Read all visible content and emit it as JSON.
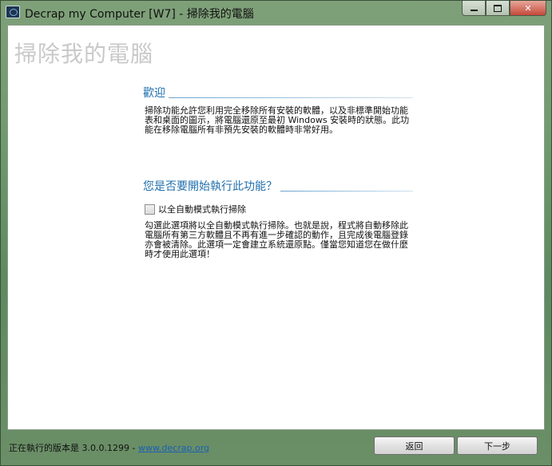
{
  "window": {
    "title": "Decrap my Computer [W7] - 掃除我的電腦",
    "minimize": "minimize",
    "maximize": "maximize",
    "close": "✕"
  },
  "page": {
    "title": "掃除我的電腦"
  },
  "welcome": {
    "heading": "歡迎",
    "text": "掃除功能允許您利用完全移除所有安裝的軟體，以及非標準開始功能表和桌面的圖示，將電腦還原至最初 Windows 安裝時的狀態。此功能在移除電腦所有非預先安裝的軟體時非常好用。"
  },
  "question": {
    "heading": "您是否要開始執行此功能？",
    "checkbox_label": "以全自動模式執行掃除",
    "checkbox_checked": false,
    "text": "勾選此選項將以全自動模式執行掃除。也就是說，程式將自動移除此電腦所有第三方軟體且不再有進一步確認的動作，且完成後電腦登錄亦會被清除。此選項一定會建立系統還原點。僅當您知道您在做什麼時才使用此選項！"
  },
  "footer": {
    "version_text": "正在執行的版本是 3.0.0.1299 - ",
    "link_text": "www.decrap.org",
    "back_label": "返回",
    "next_label": "下一步"
  }
}
